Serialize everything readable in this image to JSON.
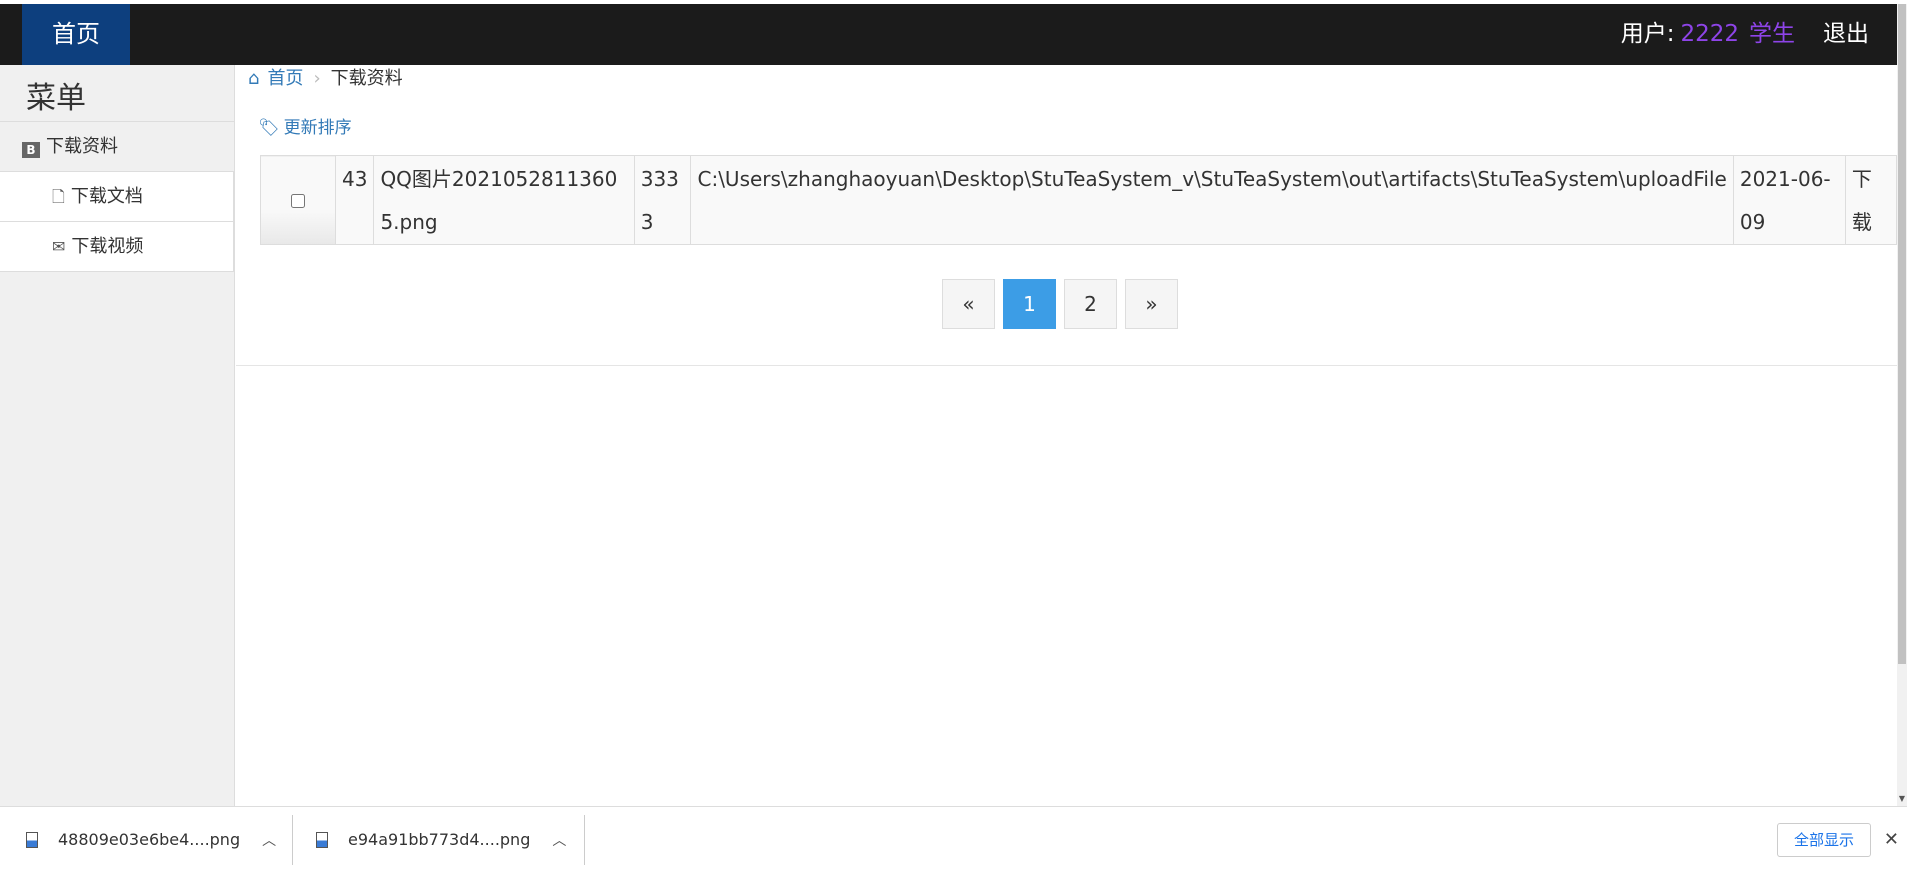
{
  "navbar": {
    "brand": "首页",
    "user_label": "用户:",
    "user_id": "2222",
    "role": "学生",
    "logout": "退出"
  },
  "sidebar": {
    "title": "菜单",
    "section": "下载资料",
    "items": [
      {
        "label": "下载文档",
        "icon": "file-icon"
      },
      {
        "label": "下载视频",
        "icon": "envelope-icon"
      }
    ]
  },
  "breadcrumb": {
    "home": "首页",
    "current": "下载资料"
  },
  "sort_link": "更新排序",
  "table": {
    "rows": [
      {
        "id": "43",
        "name": "QQ图片20210528113605.png",
        "size": "3333",
        "path": "C:\\Users\\zhanghaoyuan\\Desktop\\StuTeaSystem_v\\StuTeaSystem\\out\\artifacts\\StuTeaSystem\\uploadFile",
        "date": "2021-06-09",
        "action": "下载"
      }
    ]
  },
  "pagination": {
    "prev": "«",
    "pages": [
      "1",
      "2"
    ],
    "active_page": "1",
    "next": "»"
  },
  "downloads": {
    "items": [
      {
        "name": "48809e03e6be4....png"
      },
      {
        "name": "e94a91bb773d4....png"
      }
    ],
    "show_all": "全部显示",
    "close": "✕"
  },
  "colors": {
    "navbar_bg": "#1b1b1b",
    "brand_bg": "#0d3f7e",
    "user_accent": "#8e44e8",
    "link": "#337ab7",
    "active_page": "#3c9de6"
  }
}
